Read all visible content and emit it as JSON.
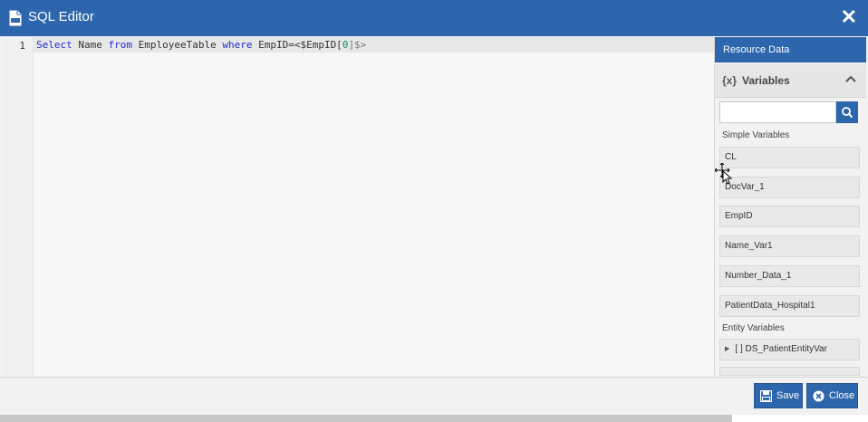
{
  "window": {
    "title": "SQL Editor",
    "title_icon": "sql-file-icon",
    "close_icon": "close-icon",
    "close_glyph": "✕"
  },
  "editor": {
    "line_number": "1",
    "code": {
      "kw_select": "Select",
      "t_name": " Name ",
      "kw_from": "from",
      "t_table": " EmployeeTable ",
      "kw_where": "where",
      "t_empid": " EmpID=",
      "t_var_open": "<$EmpID[",
      "t_index": "0",
      "t_var_close": "]$>"
    }
  },
  "resource_panel": {
    "header": "Resource Data",
    "section_icon": "{x}",
    "section_title": "Variables",
    "search_placeholder": "",
    "search_icon": "search-icon",
    "simple_label": "Simple Variables",
    "simple_variables": [
      "CL",
      "DocVar_1",
      "EmpID",
      "Name_Var1",
      "Number_Data_1",
      "PatientData_Hospital1"
    ],
    "entity_label": "Entity Variables",
    "entity_variables": [
      "[ ] DS_PatientEntityVar"
    ]
  },
  "footer": {
    "save_label": "Save",
    "close_label": "Close"
  },
  "colors": {
    "accent": "#2d66ad",
    "keyword": "#1f2fd6",
    "number": "#0a8f6a"
  }
}
